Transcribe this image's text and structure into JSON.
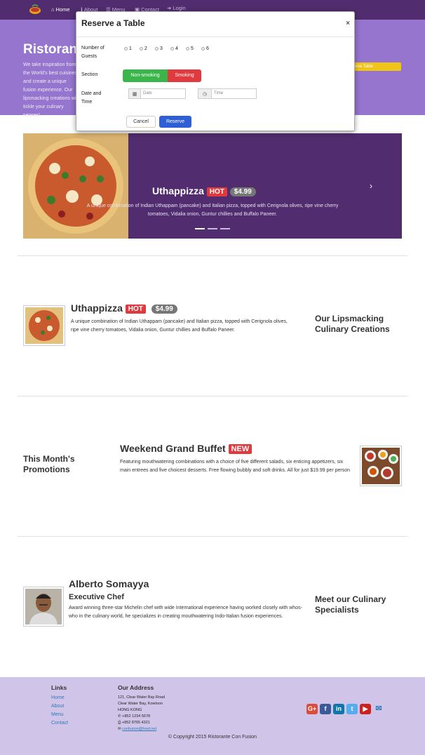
{
  "nav": {
    "home": "Home",
    "about": "About",
    "menu": "Menu",
    "contact": "Contact",
    "login": "Login"
  },
  "jumbotron": {
    "title": "Ristorante",
    "text": "We take inspiration from the World's best cuisines, and create a unique fusion experience. Our lipsmacking creations will tickle your culinary senses!",
    "reserve_button": "Reserve Table"
  },
  "modal": {
    "title": "Reserve a Table",
    "close": "×",
    "guests_label": "Number of Guests",
    "guest_options": [
      "1",
      "2",
      "3",
      "4",
      "5",
      "6"
    ],
    "section_label": "Section",
    "section_options": [
      "Non-smoking",
      "Smoking"
    ],
    "datetime_label": "Date and Time",
    "date_placeholder": "Date",
    "time_placeholder": "Time",
    "cancel": "Cancel",
    "reserve": "Reserve"
  },
  "carousel": {
    "title": "Uthappizza",
    "badge": "HOT",
    "price": "$4.99",
    "description": "A unique combination of Indian Uthappam (pancake) and Italian pizza, topped with Cerignola olives, ripe vine cherry tomatoes, Vidalia onion, Guntur chillies and Buffalo Paneer.",
    "indicator_count": 3,
    "active_indicator": 0
  },
  "dish": {
    "title": "Uthappizza",
    "badge": "HOT",
    "price": "$4.99",
    "description": "A unique combination of Indian Uthappam (pancake) and Italian pizza, topped with Cerignola olives, ripe vine cherry tomatoes, Vidalia onion, Guntur chillies and Buffalo Paneer.",
    "side_heading": "Our Lipsmacking Culinary Creations"
  },
  "promotion": {
    "side_heading": "This Month's Promotions",
    "title": "Weekend Grand Buffet",
    "badge": "NEW",
    "description": "Featuring mouthwatering combinations with a choice of five different salads, six enticing appetizers, six main entrees and five choicest desserts. Free flowing bubbly and soft drinks. All for just $19.99 per person"
  },
  "chef": {
    "name": "Alberto Somayya",
    "role": "Executive Chef",
    "description": "Award winning three-star Michelin chef with wide International experience having worked closely with whos-who in the culinary world, he specializes in creating mouthwatering Indo-Italian fusion experiences.",
    "side_heading": "Meet our Culinary Specialists"
  },
  "footer": {
    "links_heading": "Links",
    "links": [
      "Home",
      "About",
      "Menu",
      "Contact"
    ],
    "address_heading": "Our Address",
    "address_lines": [
      "121, Clear Water Bay Road",
      "Clear Water Bay, Kowloon",
      "HONG KONG"
    ],
    "phone": "+852 1234 5678",
    "fax": "+852 8765 4321",
    "email": "confusion@food.net",
    "social_icons": [
      "google-plus-icon",
      "facebook-icon",
      "linkedin-icon",
      "twitter-icon",
      "youtube-icon",
      "envelope-icon"
    ],
    "copyright": "© Copyright 2015 Ristorante Con Fusion"
  },
  "colors": {
    "navbar": "#512c6e",
    "jumbotron": "#9575cd",
    "footer": "#d1c4e9",
    "hot_badge": "#e03a3e",
    "reserve_button": "#2f5fd7",
    "nonsmoking": "#39b54a",
    "smoking": "#e03a3e"
  }
}
